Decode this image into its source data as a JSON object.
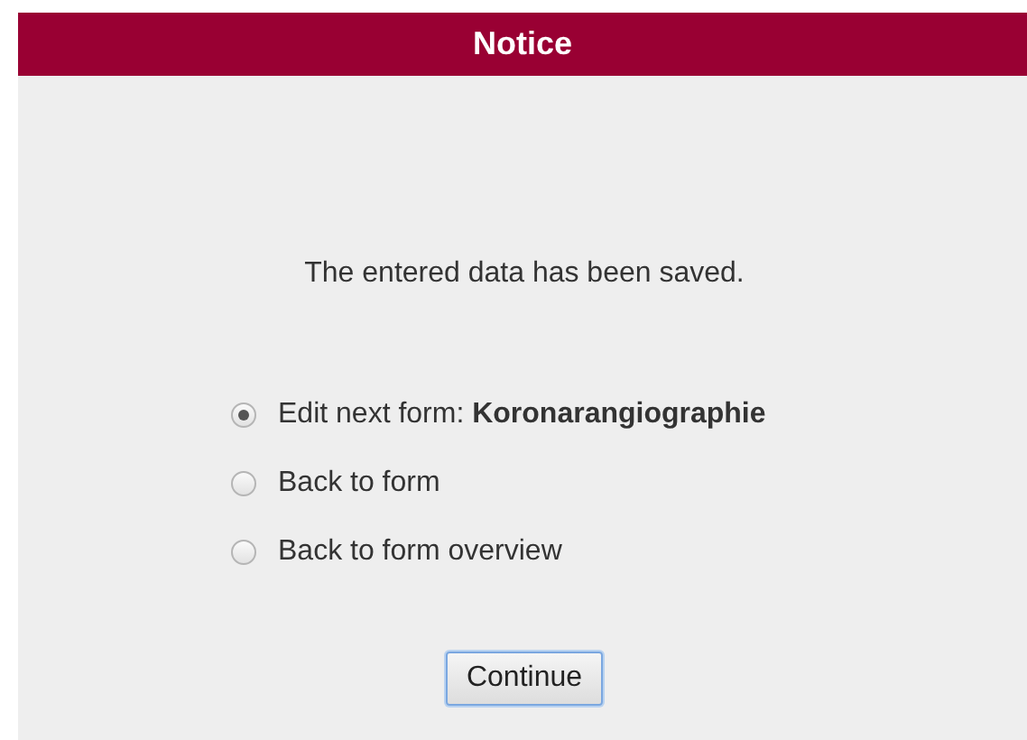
{
  "header": {
    "title": "Notice"
  },
  "message": "The entered data has been saved.",
  "options": [
    {
      "label": "Edit next form: **Koronarangiographie**",
      "selected": true
    },
    {
      "label": "Back to form",
      "selected": false
    },
    {
      "label": "Back to form overview",
      "selected": false
    }
  ],
  "button": "Continue"
}
